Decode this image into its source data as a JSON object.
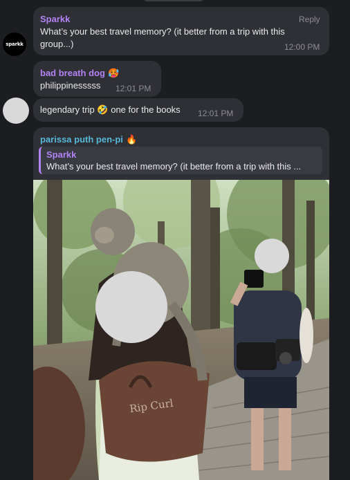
{
  "messages": [
    {
      "sender": "Sparkk",
      "avatar_text": "sparkk",
      "action": "Reply",
      "text": "What’s your best travel memory? (it better from a trip with this group...)",
      "line1": "What’s your best travel memory? (it better from a trip with this",
      "line2": "group...)",
      "time": "12:00 PM"
    },
    {
      "sender": "bad breath dog",
      "emoji": "🥵",
      "text": "philippinesssss",
      "time": "12:01 PM"
    },
    {
      "text": "legendary trip 🤣 one for the books",
      "text_a": "legendary trip",
      "emoji": "🤣",
      "text_b": "one for the books",
      "time": "12:01 PM"
    },
    {
      "sender": "parissa puth pen-pi",
      "emoji": "🔥",
      "quote_sender": "Sparkk",
      "quote_text": "What’s your best travel memory? (it better from a trip with this ...",
      "photo_text": "Rip Curl"
    }
  ],
  "colors": {
    "background": "#1c1d21",
    "bubble": "#2f3035",
    "accent_purple": "#b283f5",
    "accent_teal": "#55b8d9",
    "timestamp": "#8c8d93"
  }
}
